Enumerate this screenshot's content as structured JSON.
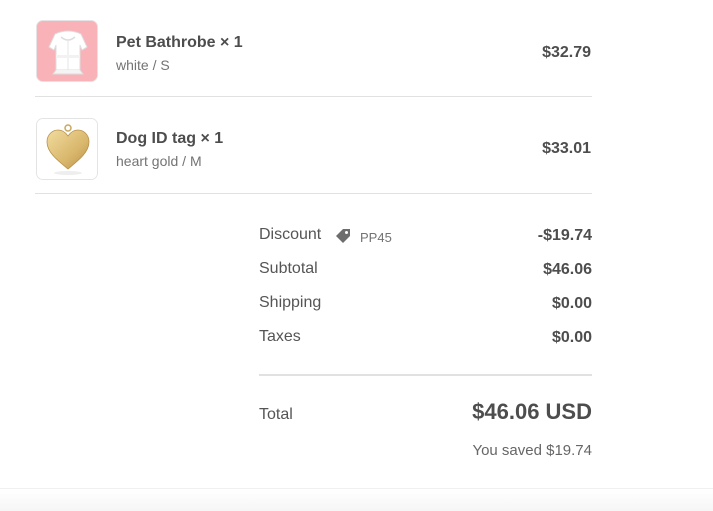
{
  "items": [
    {
      "name": "Pet Bathrobe × 1",
      "variant": "white / S",
      "price": "$32.79",
      "image_icon": "pet-bathrobe-image"
    },
    {
      "name": "Dog ID tag × 1",
      "variant": "heart gold / M",
      "price": "$33.01",
      "image_icon": "gold-heart-tag-image"
    }
  ],
  "totals": {
    "discount_label": "Discount",
    "discount_code": "PP45",
    "discount_value": "-$19.74",
    "subtotal_label": "Subtotal",
    "subtotal_value": "$46.06",
    "shipping_label": "Shipping",
    "shipping_value": "$0.00",
    "taxes_label": "Taxes",
    "taxes_value": "$0.00",
    "total_label": "Total",
    "total_value": "$46.06 USD",
    "saved_text": "You saved $19.74"
  },
  "colors": {
    "bathrobe_bg": "#f9b2b7",
    "gold": "#d9b76c",
    "text": "#4d4d4d",
    "muted": "#737373"
  }
}
